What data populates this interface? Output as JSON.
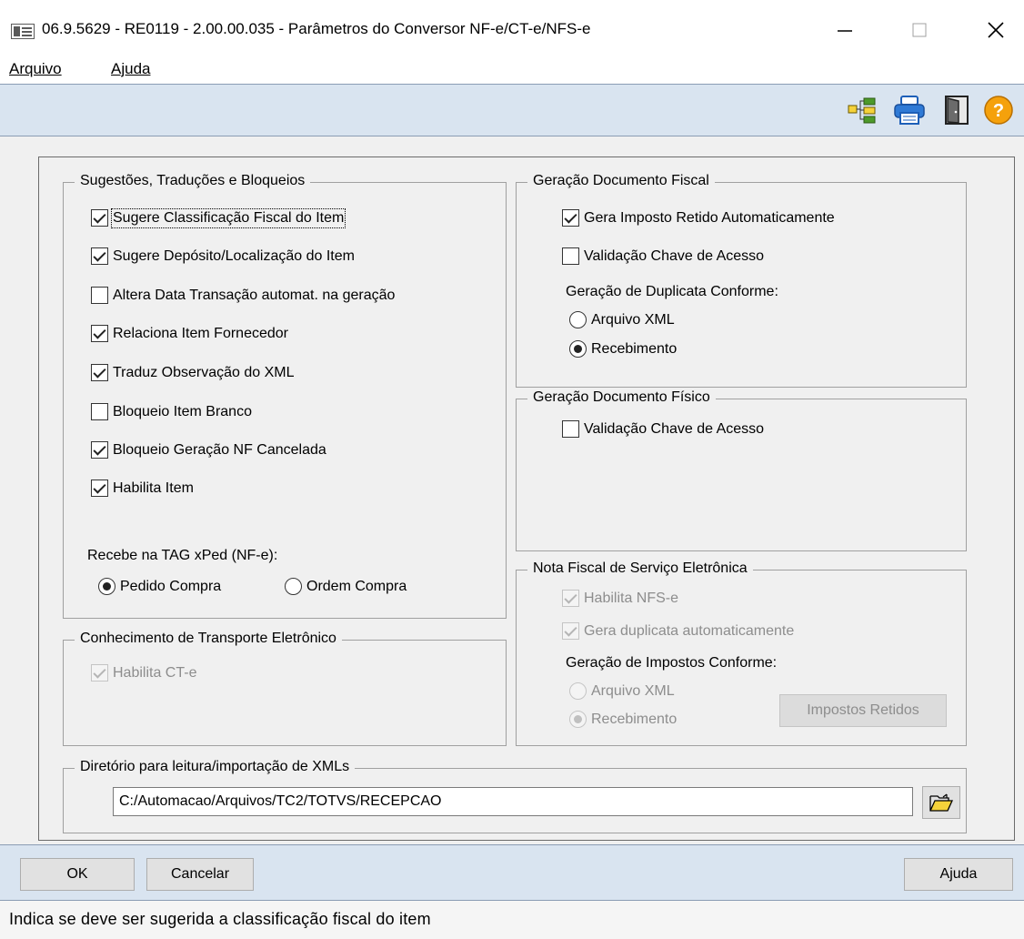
{
  "window": {
    "title": "06.9.5629 - RE0119 - 2.00.00.035 - Parâmetros do Conversor NF-e/CT-e/NFS-e"
  },
  "menu": {
    "items": [
      {
        "label": "Arquivo"
      },
      {
        "label": "Ajuda"
      }
    ]
  },
  "toolbar": {
    "icons": [
      "tree-structure-icon",
      "print-icon",
      "exit-door-icon",
      "help-icon"
    ]
  },
  "sugestoes": {
    "title": "Sugestões, Traduções e Bloqueios",
    "items": [
      {
        "label": "Sugere Classificação Fiscal do Item",
        "checked": true
      },
      {
        "label": "Sugere Depósito/Localização do Item",
        "checked": true
      },
      {
        "label": "Altera Data Transação automat. na geração",
        "checked": false
      },
      {
        "label": "Relaciona Item Fornecedor",
        "checked": true
      },
      {
        "label": "Traduz Observação do XML",
        "checked": true
      },
      {
        "label": "Bloqueio Item Branco",
        "checked": false
      },
      {
        "label": "Bloqueio Geração NF Cancelada",
        "checked": true
      },
      {
        "label": "Habilita Item",
        "checked": true
      }
    ],
    "xped_label": "Recebe na TAG xPed (NF-e):",
    "xped_options": [
      {
        "label": "Pedido Compra",
        "selected": true
      },
      {
        "label": "Ordem Compra",
        "selected": false
      }
    ]
  },
  "cte": {
    "title": "Conhecimento de Transporte Eletrônico",
    "habilita": {
      "label": "Habilita CT-e",
      "checked": true,
      "disabled": true
    }
  },
  "doc_fiscal": {
    "title": "Geração Documento Fiscal",
    "gera_imposto": {
      "label": "Gera Imposto Retido Automaticamente",
      "checked": true
    },
    "validacao": {
      "label": "Validação Chave de Acesso",
      "checked": false
    },
    "duplicata_label": "Geração de Duplicata Conforme:",
    "duplicata_options": [
      {
        "label": "Arquivo XML",
        "selected": false
      },
      {
        "label": "Recebimento",
        "selected": true
      }
    ]
  },
  "doc_fisico": {
    "title": "Geração Documento Físico",
    "validacao": {
      "label": "Validação Chave de Acesso",
      "checked": false
    }
  },
  "nfse": {
    "title": "Nota Fiscal de Serviço Eletrônica",
    "habilita": {
      "label": "Habilita NFS-e",
      "checked": true,
      "disabled": true
    },
    "gera_duplicata": {
      "label": "Gera duplicata automaticamente",
      "checked": true,
      "disabled": true
    },
    "impostos_label": "Geração de Impostos Conforme:",
    "impostos_options": [
      {
        "label": "Arquivo XML",
        "selected": false,
        "disabled": true
      },
      {
        "label": "Recebimento",
        "selected": true,
        "disabled": true
      }
    ],
    "impostos_retidos_button": "Impostos Retidos"
  },
  "diretorio": {
    "title": "Diretório para leitura/importação de XMLs",
    "value": "C:/Automacao/Arquivos/TC2/TOTVS/RECEPCAO"
  },
  "buttons": {
    "ok": "OK",
    "cancelar": "Cancelar",
    "ajuda": "Ajuda"
  },
  "status": {
    "text": "Indica se deve ser sugerida a classificação fiscal do item"
  }
}
